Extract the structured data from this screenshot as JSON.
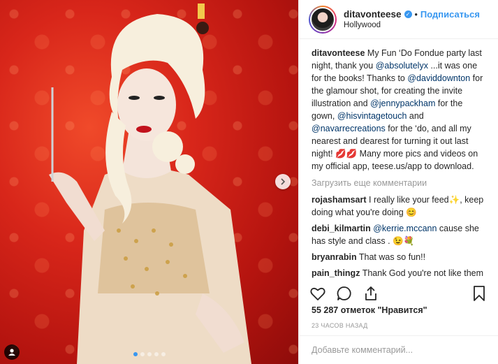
{
  "header": {
    "username": "ditavonteese",
    "follow_label": "Подписаться",
    "location": "Hollywood",
    "dot": "•"
  },
  "caption": {
    "username": "ditavonteese",
    "parts": [
      "My Fun ‘Do Fondue party last night, thank you ",
      "@absolutelyx",
      " ...it was one for the books! Thanks to ",
      "@daviddownton",
      " for the glamour shot, for creating the invite illustration and ",
      "@jennypackham",
      " for the gown, ",
      "@hisvintagetouch",
      " and ",
      "@navarrecreations",
      " for the ‘do, and all my nearest and dearest for turning it out last night! 💋💋 Many more pics and videos on my official app, teese.us/app to download."
    ]
  },
  "load_more": "Загрузить еще комментарии",
  "comments": [
    {
      "username": "rojashamsart",
      "text": "I really like your feed✨, keep doing what you're doing 😊"
    },
    {
      "username": "debi_kilmartin",
      "mention": "@kerrie.mccann",
      "text": " cause she has style and class . 😉💐"
    },
    {
      "username": "bryanrabin",
      "text": "That was so fun!!"
    },
    {
      "username": "pain_thingz",
      "text": "Thank God you're not like them dork 😋"
    }
  ],
  "likes": "55 287 отметок \"Нравится\"",
  "timestamp": "23 ЧАСОВ НАЗАД",
  "add_comment_placeholder": "Добавьте комментарий...",
  "icons": {
    "like": "heart-icon",
    "comment": "comment-icon",
    "share": "share-icon",
    "save": "bookmark-icon",
    "next": "chevron-right-icon",
    "tag": "user-tag-icon",
    "verified": "verified-badge-icon"
  },
  "carousel": {
    "count": 5,
    "active": 0
  },
  "colors": {
    "accent": "#3897f0",
    "text": "#262626",
    "muted": "#999999",
    "link": "#003569"
  }
}
